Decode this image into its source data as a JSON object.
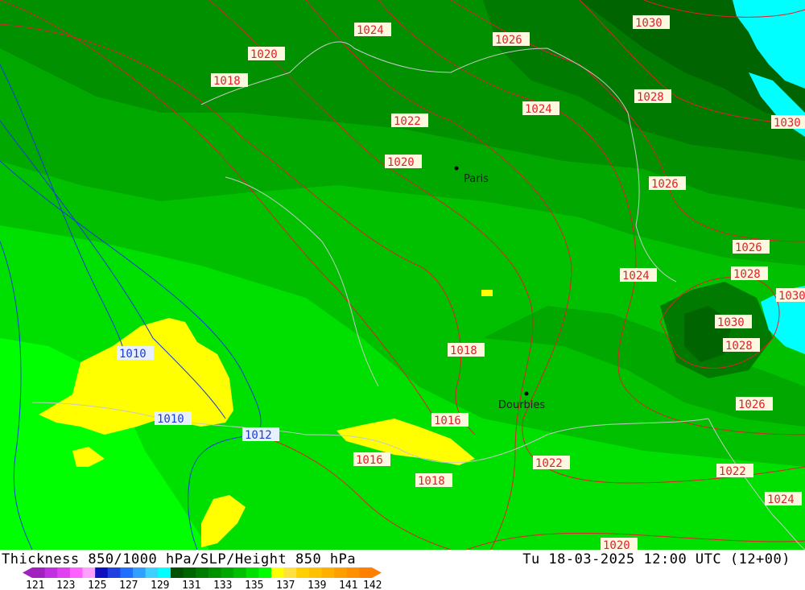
{
  "header": {
    "title_left": "Thickness 850/1000 hPa/SLP/Height 850 hPa",
    "title_right": "Tu 18-03-2025 12:00 UTC (12+00)"
  },
  "cities": [
    {
      "name": "Paris"
    },
    {
      "name": "Dourbies"
    }
  ],
  "isobars_red": [
    "1024",
    "1026",
    "1030",
    "1020",
    "1018",
    "1022",
    "1024",
    "1028",
    "1030",
    "1020",
    "1026",
    "1026",
    "1024",
    "1028",
    "1030",
    "1030",
    "1028",
    "1018",
    "1026",
    "1016",
    "1016",
    "1018",
    "1022",
    "1022",
    "1024",
    "1020"
  ],
  "isobars_blue": [
    "1010",
    "1010",
    "1012"
  ],
  "legend": {
    "ticks": [
      "121",
      "123",
      "125",
      "127",
      "129",
      "131",
      "133",
      "135",
      "137",
      "139",
      "141",
      "142"
    ],
    "colors": [
      "#a020c0",
      "#c030e0",
      "#e040f0",
      "#ff60ff",
      "#ffa0ff",
      "#1010c0",
      "#2040e0",
      "#2070ff",
      "#30a0ff",
      "#40d0ff",
      "#00ffff",
      "#005000",
      "#006400",
      "#007a00",
      "#009000",
      "#00a800",
      "#00c000",
      "#00e000",
      "#00ff00",
      "#ffff00",
      "#ffe040",
      "#ffd000",
      "#ffc000",
      "#ffb000",
      "#ffa000",
      "#ff9000",
      "#ff8000"
    ]
  },
  "colors": {
    "sea": "#00ffff",
    "isobar_red": "#e0202a",
    "isobar_blue": "#1a3cd6",
    "border": "#c8c8c8"
  }
}
